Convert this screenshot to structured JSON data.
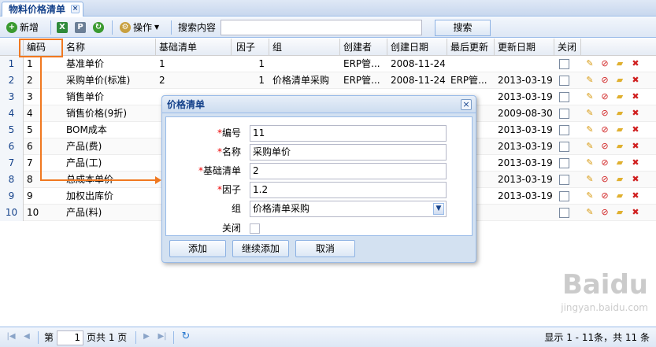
{
  "tab": {
    "title": "物料价格清单",
    "close": "×"
  },
  "toolbar": {
    "add_label": "新增",
    "actions_label": "操作",
    "search_label": "搜索内容",
    "search_value": "",
    "search_button": "搜索"
  },
  "grid": {
    "columns": [
      "编码",
      "名称",
      "基础清单",
      "因子",
      "组",
      "创建者",
      "创建日期",
      "最后更新",
      "更新日期",
      "关闭"
    ],
    "rows": [
      {
        "n": "1",
        "code": "1",
        "name": "基准单价",
        "base": "1",
        "factor": "1",
        "group": "",
        "creator": "ERP管...",
        "created": "2008-11-24",
        "updater": "",
        "updated": ""
      },
      {
        "n": "2",
        "code": "2",
        "name": "采购单价(标准)",
        "base": "2",
        "factor": "1",
        "group": "价格清单采购",
        "creator": "ERP管...",
        "created": "2008-11-24",
        "updater": "ERP管...",
        "updated": "2013-03-19"
      },
      {
        "n": "3",
        "code": "3",
        "name": "销售单价",
        "base": "",
        "factor": "",
        "group": "",
        "creator": "",
        "created": "",
        "updater": "",
        "updated": "2013-03-19"
      },
      {
        "n": "4",
        "code": "4",
        "name": "销售价格(9折)",
        "base": "",
        "factor": "",
        "group": "",
        "creator": "",
        "created": "",
        "updater": "",
        "updated": "2009-08-30"
      },
      {
        "n": "5",
        "code": "5",
        "name": "BOM成本",
        "base": "",
        "factor": "",
        "group": "",
        "creator": "",
        "created": "",
        "updater": "",
        "updated": "2013-03-19"
      },
      {
        "n": "6",
        "code": "6",
        "name": "产品(费)",
        "base": "",
        "factor": "",
        "group": "",
        "creator": "",
        "created": "",
        "updater": "",
        "updated": "2013-03-19"
      },
      {
        "n": "7",
        "code": "7",
        "name": "产品(工)",
        "base": "",
        "factor": "",
        "group": "",
        "creator": "",
        "created": "",
        "updater": "",
        "updated": "2013-03-19"
      },
      {
        "n": "8",
        "code": "8",
        "name": "总成本单价",
        "base": "",
        "factor": "",
        "group": "",
        "creator": "",
        "created": "",
        "updater": "",
        "updated": "2013-03-19"
      },
      {
        "n": "9",
        "code": "9",
        "name": "加权出库价",
        "base": "",
        "factor": "",
        "group": "",
        "creator": "",
        "created": "",
        "updater": "",
        "updated": "2013-03-19"
      },
      {
        "n": "10",
        "code": "10",
        "name": "产品(料)",
        "base": "",
        "factor": "",
        "group": "",
        "creator": "",
        "created": "",
        "updater": "",
        "updated": ""
      }
    ]
  },
  "dialog": {
    "title": "价格清单",
    "fields": {
      "code_label": "编号",
      "code_value": "11",
      "name_label": "名称",
      "name_value": "采购单价",
      "base_label": "基础清单",
      "base_value": "2",
      "factor_label": "因子",
      "factor_value": "1.2",
      "group_label": "组",
      "group_value": "价格清单采购",
      "closed_label": "关闭"
    },
    "required_mark": "*",
    "buttons": {
      "add": "添加",
      "continue_add": "继续添加",
      "cancel": "取消"
    }
  },
  "pager": {
    "page_label": "第",
    "page_value": "1",
    "of_pages": "页共 1 页",
    "summary": "显示 1 - 11条，共 11 条"
  },
  "watermark": {
    "brand": "Baidu",
    "sub": "jingyan.baidu.com"
  },
  "colors": {
    "accent": "#15428b",
    "highlight": "#f07820",
    "border": "#99bbe8"
  }
}
